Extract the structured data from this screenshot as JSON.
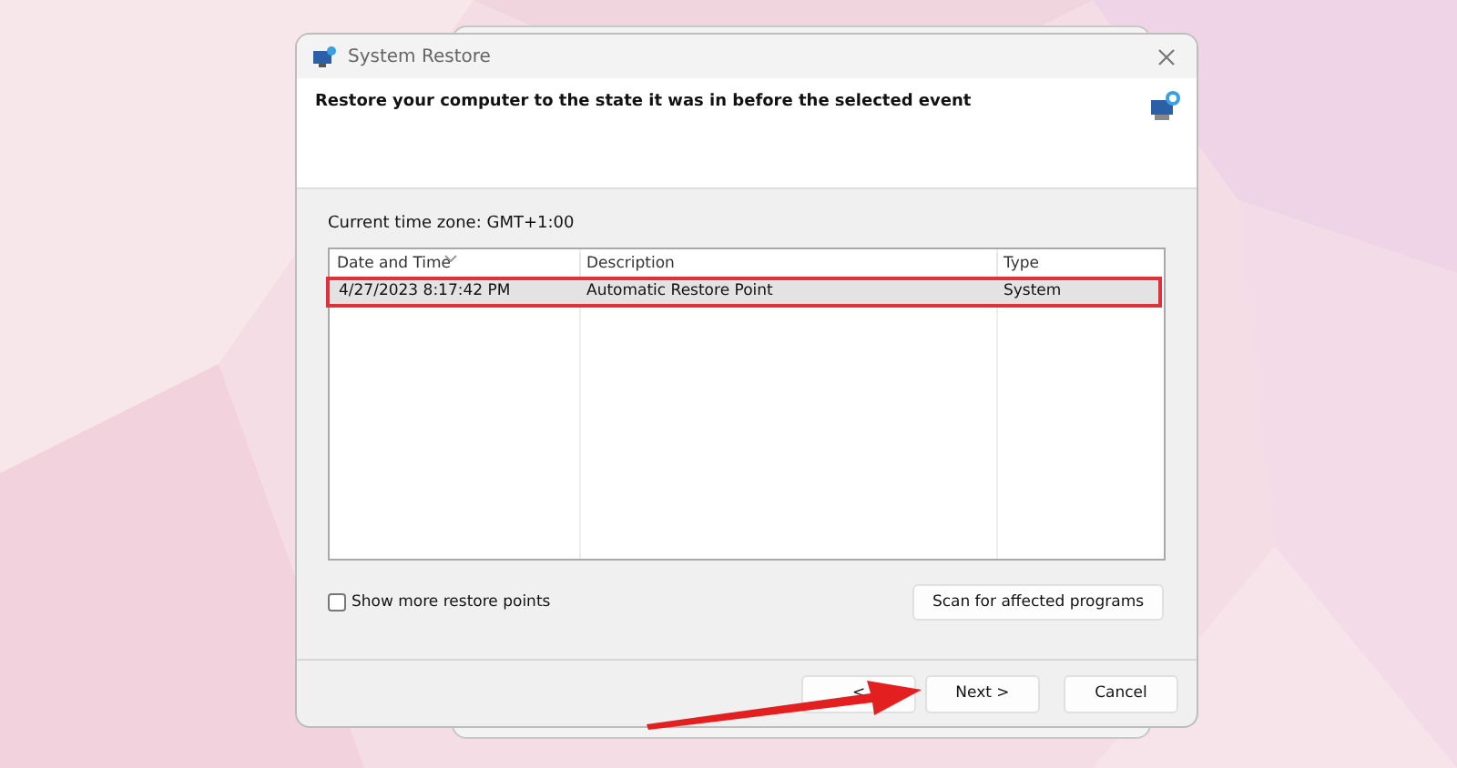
{
  "window": {
    "title": "System Restore",
    "heading": "Restore your computer to the state it was in before the selected event"
  },
  "time_zone": "Current time zone: GMT+1:00",
  "table": {
    "columns": [
      {
        "label": "Date and Time",
        "sorted": true
      },
      {
        "label": "Description",
        "sorted": false
      },
      {
        "label": "Type",
        "sorted": false
      }
    ],
    "rows": [
      {
        "cells": [
          "4/27/2023 8:17:42 PM",
          "Automatic Restore Point",
          "System"
        ],
        "selected": true,
        "outlined": true
      }
    ]
  },
  "show_more": {
    "label": "Show more restore points",
    "checked": false
  },
  "scan_button": "Scan for affected programs",
  "buttons": [
    {
      "label": "<"
    },
    {
      "label": "Next >"
    },
    {
      "label": "Cancel"
    }
  ],
  "arrow_annotation": true
}
